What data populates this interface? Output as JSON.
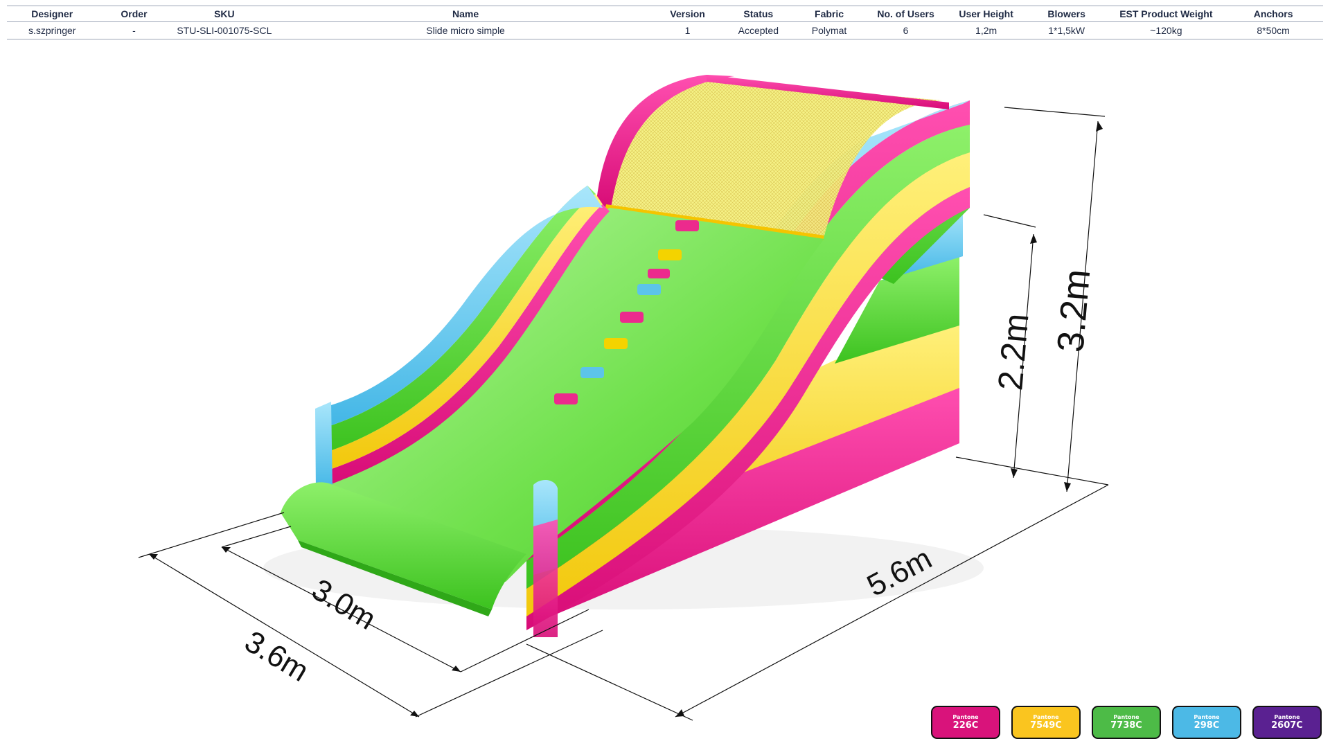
{
  "spec": {
    "headers": [
      "Designer",
      "Order",
      "SKU",
      "Name",
      "Version",
      "Status",
      "Fabric",
      "No. of Users",
      "User  Height",
      "Blowers",
      "EST Product Weight",
      "Anchors"
    ],
    "row": [
      "s.szpringer",
      "-",
      "STU-SLI-001075-SCL",
      "Slide micro simple",
      "1",
      "Accepted",
      "Polymat",
      "6",
      "1,2m",
      "1*1,5kW",
      "~120kg",
      "8*50cm"
    ]
  },
  "dimensions": {
    "width_3_6": "3.6m",
    "width_3_0": "3.0m",
    "length": "5.6m",
    "platform_height": "2.2m",
    "total_height": "3.2m"
  },
  "colors": {
    "pink": "#e0127f",
    "yellow": "#f7d51c",
    "green": "#5fd640",
    "blue": "#5cc4ea",
    "purple": "#5b1e8f"
  },
  "swatches": [
    {
      "brand": "Pantone",
      "code": "226C",
      "color": "#d9137b"
    },
    {
      "brand": "Pantone",
      "code": "7549C",
      "color": "#fac51f"
    },
    {
      "brand": "Pantone",
      "code": "7738C",
      "color": "#4dbb47"
    },
    {
      "brand": "Pantone",
      "code": "298C",
      "color": "#4cb9e6"
    },
    {
      "brand": "Pantone",
      "code": "2607C",
      "color": "#5a2191"
    }
  ]
}
